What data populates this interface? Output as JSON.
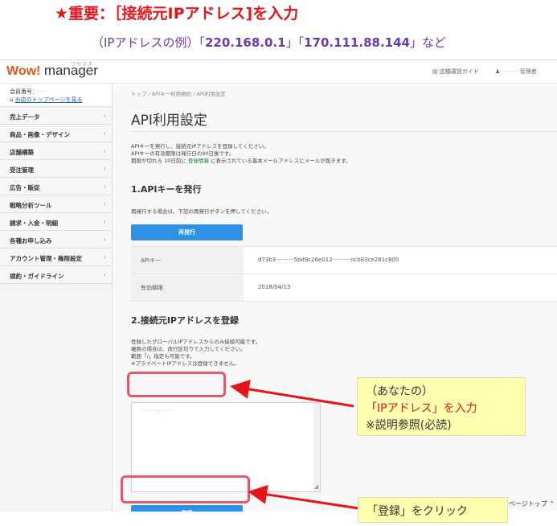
{
  "instructions": {
    "title": "★重要：［接続元IPアドレス]を入力",
    "example_prefix": "（IPアドレスの例）「",
    "example_ip1": "220.168.0.1",
    "example_mid": "」「",
    "example_ip2": "170.111.88.144",
    "example_suffix": "」など"
  },
  "app": {
    "logo_wow": "Wow!",
    "logo_manager": "manager",
    "logo_kana": "ワウマネージャー",
    "nav_guide": "店舗運営ガイド",
    "nav_user": "管理者"
  },
  "sidebar": {
    "member_label": "会員番号：",
    "member_link": "お店のトップページを見る",
    "items": [
      {
        "label": "売上データ"
      },
      {
        "label": "商品・画像・デザイン"
      },
      {
        "label": "店舗構築"
      },
      {
        "label": "受注管理"
      },
      {
        "label": "広告・販促"
      },
      {
        "label": "戦略分析ツール"
      },
      {
        "label": "請求・入金・明細"
      },
      {
        "label": "各種お申し込み"
      },
      {
        "label": "アカウント管理・権限設定"
      },
      {
        "label": "規約・ガイドライン"
      }
    ]
  },
  "main": {
    "breadcrumb": "トップ / APIキー利用規約 / API利用設定",
    "title": "API利用設定",
    "desc1": "APIキーを発行し、接続元IPアドレスを登録してください。",
    "desc2": "APIキーの有効期限は発行日の90日後です。",
    "desc3_pre": "期限が切れる 10日前に ",
    "desc3_link": "登録情報",
    "desc3_post": " に表示されている基本メールアドレスにメールが届きます。",
    "sec1": "1.APIキーを発行",
    "reissue_note": "再発行する場合は、下記の再発行ボタンを押してください。",
    "reissue_button": "再発行",
    "apikey_label": "APIキー",
    "apikey_value": "d73b3··········5bd9c26e012··········ncb83ce281c800",
    "expiry_label": "有効期限",
    "expiry_value": "2018/04/13",
    "sec2": "2.接続元IPアドレスを登録",
    "ip_desc1": "登録したグローバルIPアドレスからのみ接続可能です。",
    "ip_desc2": "複数の場合は、改行区切りで入力してください。",
    "ip_desc3": "範囲「/」指定も可能です。",
    "ip_desc4": "※プライベートIPアドレスは登録できません。",
    "ip_value": "···.···.···.···",
    "register_button": "登録",
    "pagetop": "ページトップ"
  },
  "callouts": {
    "ip_line1": "（あなたの）",
    "ip_line2": "「IPアドレス」を入力",
    "ip_line3": "※説明参照(必読)",
    "click_line": "「登録」をクリック"
  },
  "colors": {
    "accent_red": "#e4151b",
    "button_blue": "#2e92e4",
    "highlight": "#e05a6a",
    "callout_bg": "#ffffb0"
  }
}
